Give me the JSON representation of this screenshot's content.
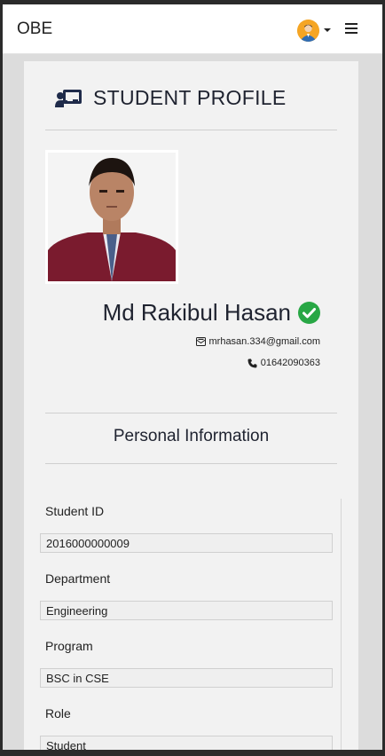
{
  "navbar": {
    "brand": "OBE",
    "avatar_icon": "user-avatar-icon",
    "menu_icon": "hamburger-menu-icon",
    "accent": "#f5a524"
  },
  "profile": {
    "heading": "STUDENT PROFILE",
    "heading_icon": "teacher-board-icon",
    "name": "Md Rakibul Hasan",
    "verified_icon": "check-circle-icon",
    "verified_color": "#28a745",
    "email": "mrhasan.334@gmail.com",
    "phone": "01642090363",
    "photo_alt": "student-photo"
  },
  "personal_info": {
    "title": "Personal Information",
    "fields": [
      {
        "label": "Student ID",
        "value": "2016000000009"
      },
      {
        "label": "Department",
        "value": "Engineering"
      },
      {
        "label": "Program",
        "value": "BSC in CSE"
      },
      {
        "label": "Role",
        "value": "Student"
      }
    ]
  }
}
